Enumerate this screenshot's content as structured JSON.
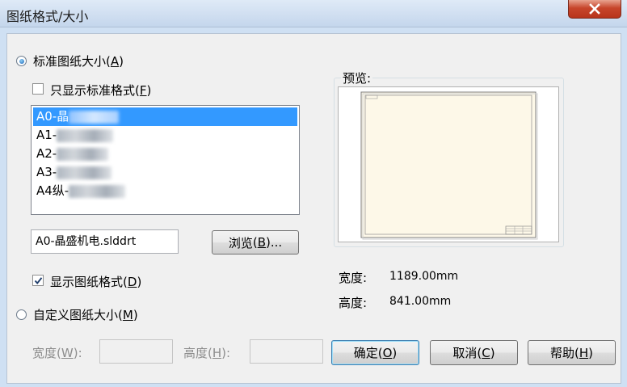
{
  "window": {
    "title": "图纸格式/大小"
  },
  "standard_size": {
    "label": "标准图纸大小",
    "mnemonic": "A",
    "selected": true
  },
  "only_standard": {
    "label": "只显示标准格式",
    "mnemonic": "F",
    "checked": false
  },
  "sheet_list": {
    "items": [
      {
        "prefix": "A0-晶",
        "selected": true
      },
      {
        "prefix": "A1-",
        "selected": false
      },
      {
        "prefix": "A2-",
        "selected": false
      },
      {
        "prefix": "A3-",
        "selected": false
      },
      {
        "prefix": "A4纵-",
        "selected": false
      }
    ]
  },
  "format_file": {
    "value": "A0-晶盛机电.slddrt"
  },
  "browse_button": {
    "label": "浏览",
    "mnemonic": "B",
    "suffix": "..."
  },
  "show_format": {
    "label": "显示图纸格式",
    "mnemonic": "D",
    "checked": true
  },
  "custom_size": {
    "label": "自定义图纸大小",
    "mnemonic": "M",
    "selected": false
  },
  "custom_width": {
    "label": "宽度",
    "mnemonic": "W",
    "suffix": ":",
    "value": ""
  },
  "custom_height": {
    "label": "高度",
    "mnemonic": "H",
    "suffix": ":",
    "value": ""
  },
  "preview": {
    "title": "预览:"
  },
  "dimensions": {
    "width_label": "宽度:",
    "width_value": "1189.00mm",
    "height_label": "高度:",
    "height_value": "841.00mm"
  },
  "buttons": {
    "ok": {
      "label": "确定",
      "mnemonic": "O"
    },
    "cancel": {
      "label": "取消",
      "mnemonic": "C"
    },
    "help": {
      "label": "帮助",
      "mnemonic": "H"
    }
  },
  "colors": {
    "selection": "#3399ff",
    "close_button": "#c7452b",
    "sheet_paper": "#fdf8e8"
  }
}
